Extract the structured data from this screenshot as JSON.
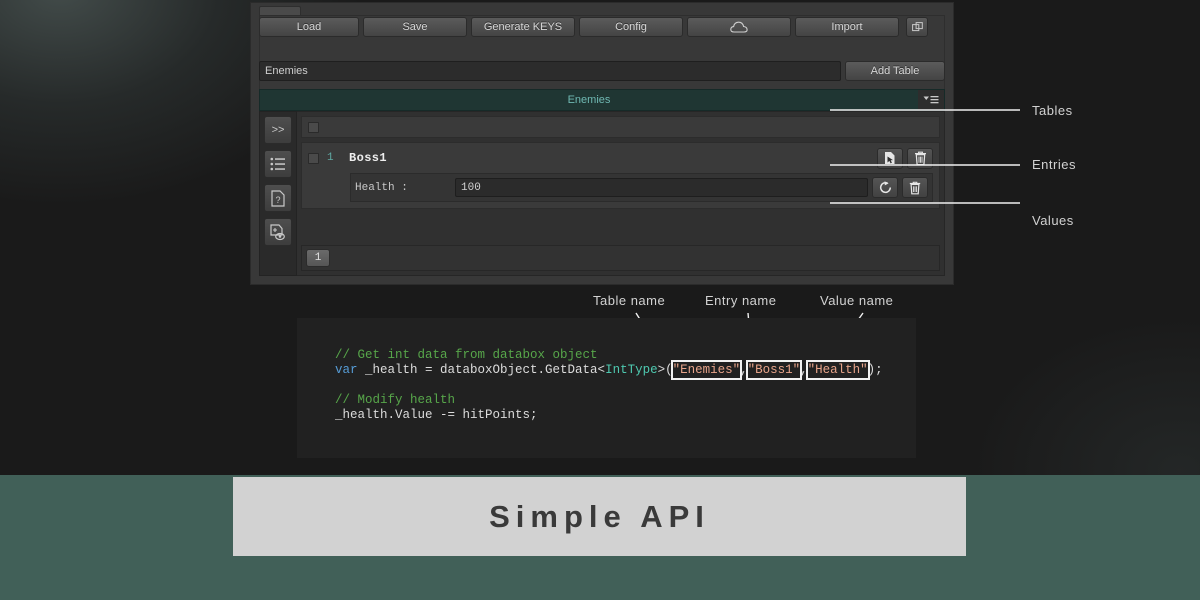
{
  "window": {
    "toolbar": {
      "buttons": [
        {
          "label": "Load",
          "name": "load-button"
        },
        {
          "label": "Save",
          "name": "save-button"
        },
        {
          "label": "Generate KEYS",
          "name": "generate-keys-button"
        },
        {
          "label": "Config",
          "name": "config-button"
        },
        {
          "label": "",
          "name": "cloud-button"
        },
        {
          "label": "Import",
          "name": "import-button"
        },
        {
          "label": "",
          "name": "detach-window-button"
        }
      ]
    },
    "name_row": {
      "input_value": "Enemies",
      "input_placeholder": "Table name",
      "add_table_label": "Add Table"
    },
    "side_rail": [
      {
        "name": "expand-button",
        "glyph": ">>"
      },
      {
        "name": "list-icon",
        "glyph": ""
      },
      {
        "name": "help-doc-icon",
        "glyph": ""
      },
      {
        "name": "preview-doc-icon",
        "glyph": ""
      }
    ],
    "table": {
      "title": "Enemies",
      "entries": [
        {
          "index": "1",
          "name": "Boss1",
          "values": [
            {
              "label": "Health :",
              "value": "100"
            }
          ]
        }
      ],
      "pager": {
        "current_page": "1"
      }
    }
  },
  "callouts": {
    "right": [
      {
        "label": "Tables"
      },
      {
        "label": "Entries"
      },
      {
        "label": "Values"
      }
    ],
    "code": [
      {
        "label": "Table name"
      },
      {
        "label": "Entry name"
      },
      {
        "label": "Value name"
      }
    ]
  },
  "code_block": {
    "line1_comment": "// Get int data from databox object",
    "line2": {
      "keyword": "var",
      "mid": " _health = databoxObject.GetData<",
      "type": "IntType",
      "open": ">(",
      "arg1": "\"Enemies\"",
      "sep1": ",",
      "arg2": "\"Boss1\"",
      "sep2": ",",
      "arg3": "\"Health\"",
      "close": ");"
    },
    "line3_comment": "// Modify health",
    "line4": "_health.Value -= hitPoints;"
  },
  "banner": {
    "text": "Simple API"
  },
  "colors": {
    "accent_teal": "#6fb8b2",
    "background_teal": "#416058",
    "background_dark": "#1a1a1a",
    "banner_bg": "#d2d2d2",
    "code_string": "#e8a48a",
    "code_comment": "#57a64a",
    "code_keyword": "#569cd6",
    "code_type": "#4ec9b0"
  }
}
